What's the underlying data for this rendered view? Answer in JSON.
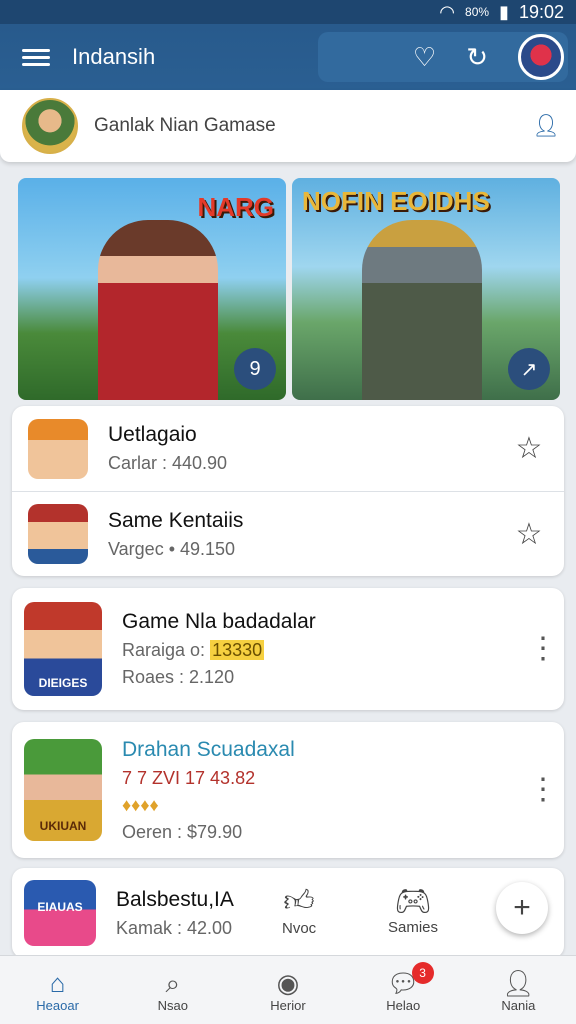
{
  "status_bar": {
    "signal": "▲",
    "battery_pct": "80%",
    "time": "19:02"
  },
  "app_bar": {
    "title": "Indansih"
  },
  "search": {
    "text": "Ganlak Nian Gamase"
  },
  "banners": [
    {
      "title": "NARG",
      "badge": "9"
    },
    {
      "title": "NOFIN EOIDHS",
      "badge": "↗"
    }
  ],
  "list_card": {
    "items": [
      {
        "title": "Uetlagaio",
        "subtitle": "Carlar : 440.90"
      },
      {
        "title": "Same Kentaiis",
        "subtitle": "Vargec • 49.150"
      }
    ]
  },
  "card_game": {
    "thumb_text": "DIEIGES",
    "title": "Game Nla badadalar",
    "line1_prefix": "Raraiga o:",
    "line1_value": "13330",
    "line2": "Roaes : 2.120"
  },
  "card_drahan": {
    "thumb_text": "UKIUAN",
    "title": "Drahan Scuadaxal",
    "line1": "7 7 ZVI 17 43.82",
    "line3": "Oeren : $79.90"
  },
  "card_bottom": {
    "thumb_text": "EIAUAS",
    "title": "Balsbestu,IA",
    "subtitle": "Kamak : 42.00",
    "action1": "Nvoc",
    "action2": "Samies"
  },
  "bottom_nav": [
    {
      "label": "Heaoar"
    },
    {
      "label": "Nsao"
    },
    {
      "label": "Herior"
    },
    {
      "label": "Helao",
      "badge": "3"
    },
    {
      "label": "Nania"
    }
  ]
}
